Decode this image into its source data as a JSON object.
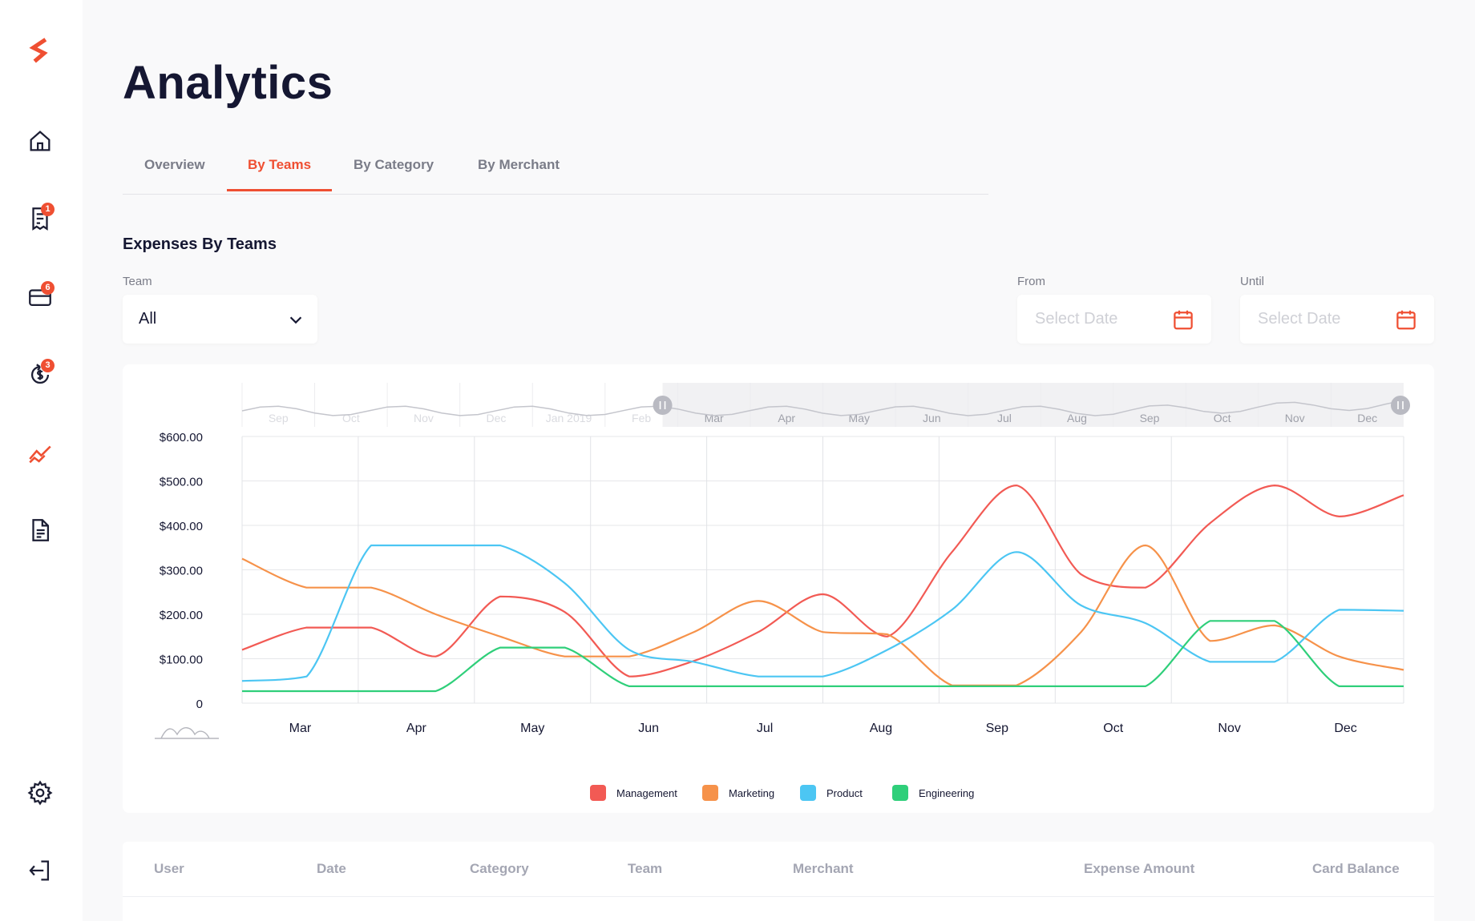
{
  "app": {
    "page_title": "Analytics",
    "accent": "#ef4f32"
  },
  "sidebar": {
    "items": [
      {
        "icon": "logo-icon"
      },
      {
        "icon": "home-icon"
      },
      {
        "icon": "receipt-icon",
        "badge": "1"
      },
      {
        "icon": "card-icon",
        "badge": "6"
      },
      {
        "icon": "refund-icon",
        "badge": "3"
      },
      {
        "icon": "analytics-icon",
        "active": true
      },
      {
        "icon": "document-icon"
      },
      {
        "icon": "settings-icon"
      },
      {
        "icon": "logout-icon"
      }
    ]
  },
  "tabs": [
    {
      "label": "Overview"
    },
    {
      "label": "By Teams",
      "active": true
    },
    {
      "label": "By Category"
    },
    {
      "label": "By Merchant"
    }
  ],
  "section": {
    "title": "Expenses By Teams"
  },
  "filters": {
    "team_label": "Team",
    "team_value": "All",
    "from_label": "From",
    "from_placeholder": "Select Date",
    "until_label": "Until",
    "until_placeholder": "Select Date"
  },
  "chart_data": {
    "type": "line",
    "categories": [
      "Mar",
      "Apr",
      "May",
      "Jun",
      "Jul",
      "Aug",
      "Sep",
      "Oct",
      "Nov",
      "Dec"
    ],
    "y_ticks": [
      "$600.00",
      "$500.00",
      "$400.00",
      "$300.00",
      "$200.00",
      "$100.00",
      "0"
    ],
    "ylim": [
      0,
      600
    ],
    "navigator_labels": [
      "Sep",
      "Oct",
      "Nov",
      "Dec",
      "Jan 2019",
      "Feb",
      "Mar",
      "Apr",
      "May",
      "Jun",
      "Jul",
      "Aug",
      "Sep",
      "Oct",
      "Nov",
      "Dec"
    ],
    "grid": true,
    "legend_position": "bottom-center",
    "series": [
      {
        "name": "Management",
        "color": "#f25a54",
        "values": [
          120,
          170,
          170,
          105,
          240,
          205,
          60,
          95,
          160,
          245,
          150,
          340,
          490,
          290,
          260,
          405,
          490,
          420,
          468
        ]
      },
      {
        "name": "Marketing",
        "color": "#f6924a",
        "values": [
          325,
          260,
          260,
          200,
          150,
          105,
          105,
          160,
          230,
          160,
          155,
          40,
          40,
          160,
          355,
          140,
          175,
          105,
          75
        ]
      },
      {
        "name": "Product",
        "color": "#4cc6f3",
        "values": [
          50,
          60,
          355,
          355,
          355,
          270,
          120,
          93,
          60,
          60,
          120,
          210,
          340,
          220,
          180,
          93,
          93,
          210,
          208
        ]
      },
      {
        "name": "Engineering",
        "color": "#2fcf7a",
        "values": [
          27,
          27,
          27,
          27,
          125,
          125,
          38,
          38,
          38,
          38,
          38,
          38,
          38,
          38,
          38,
          185,
          185,
          38,
          38
        ]
      }
    ]
  },
  "table": {
    "columns": [
      "User",
      "Date",
      "Category",
      "Team",
      "Merchant",
      "Expense Amount",
      "Card Balance"
    ]
  }
}
